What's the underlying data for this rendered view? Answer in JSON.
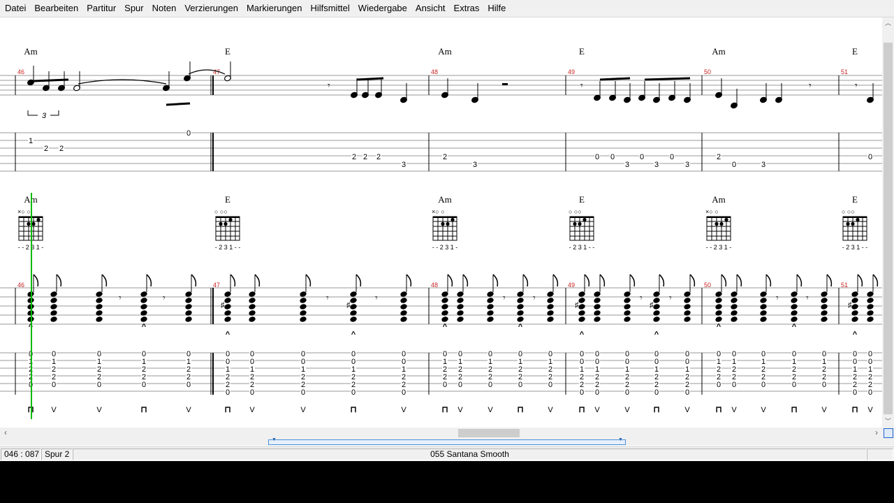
{
  "menu": [
    "Datei",
    "Bearbeiten",
    "Partitur",
    "Spur",
    "Noten",
    "Verzierungen",
    "Markierungen",
    "Hilfsmittel",
    "Wiedergabe",
    "Ansicht",
    "Extras",
    "Hilfe"
  ],
  "status": {
    "position": "046 : 087",
    "track": "Spur 2",
    "title": "055  Santana  Smooth"
  },
  "colors": {
    "measure_number": "#cc2222",
    "cursor": "#00bb00",
    "menubar": "#f0f0f0"
  },
  "system1": {
    "chords": [
      "Am",
      "E",
      "Am",
      "E",
      "Am",
      "E"
    ],
    "measure_numbers": [
      "46",
      "47",
      "48",
      "49",
      "50",
      "51"
    ],
    "triplet_label": "3",
    "tab_fret_rows": [
      {
        "string": 1,
        "frets": [
          "0",
          "0"
        ]
      },
      {
        "string": 2,
        "frets": [
          "1"
        ]
      },
      {
        "string": 3,
        "frets": [
          "2",
          "2"
        ]
      },
      {
        "string": 5,
        "frets": [
          "2",
          "2",
          "2",
          "2"
        ]
      },
      {
        "string": 5,
        "frets": [
          "0",
          "0",
          "0",
          "0",
          "0",
          "2",
          "0",
          "0"
        ]
      },
      {
        "string": 6,
        "frets": [
          "3",
          "3",
          "3",
          "3",
          "3",
          "3",
          "3"
        ]
      }
    ]
  },
  "system2": {
    "chords": [
      "Am",
      "E",
      "Am",
      "E",
      "Am",
      "E"
    ],
    "measure_numbers": [
      "46",
      "47",
      "48",
      "49",
      "50",
      "51"
    ],
    "diagrams": [
      {
        "chord": "Am",
        "top": "×○      ○",
        "fingering": "- - 2 3 1 -"
      },
      {
        "chord": "E",
        "top": "○        ○○",
        "fingering": "- 2 3 1 - -"
      },
      {
        "chord": "Am",
        "top": "×○      ○",
        "fingering": "- - 2 3 1 -"
      },
      {
        "chord": "E",
        "top": "○        ○○",
        "fingering": "- 2 3 1 - -"
      },
      {
        "chord": "Am",
        "top": "×○      ○",
        "fingering": "- - 2 3 1 -"
      },
      {
        "chord": "E",
        "top": "○        ○○",
        "fingering": "- 2 3 1 - -"
      }
    ],
    "am_column": [
      "0",
      "1",
      "2",
      "2",
      "0"
    ],
    "e_column": [
      "0",
      "0",
      "1",
      "2",
      "2",
      "0"
    ],
    "strum_down": "⊓",
    "strum_up": "V"
  }
}
